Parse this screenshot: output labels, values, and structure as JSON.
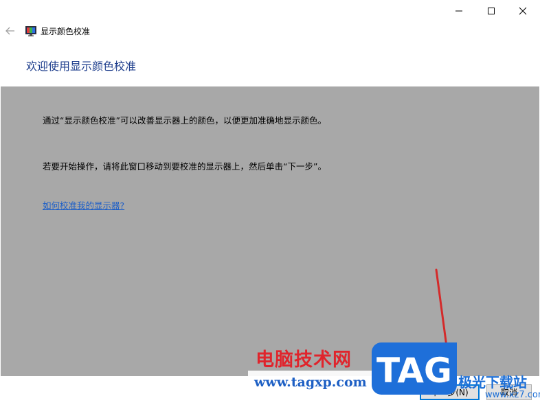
{
  "window": {
    "title": "显示颜色校准",
    "controls": {
      "minimize": "minimize-icon",
      "maximize": "maximize-icon",
      "close": "close-icon"
    }
  },
  "header": {
    "back_icon": "back-arrow-icon",
    "app_icon": "monitor-icon",
    "heading": "欢迎使用显示颜色校准"
  },
  "content": {
    "paragraph_1": "通过“显示颜色校准”可以改善显示器上的颜色，以便更加准确地显示颜色。",
    "paragraph_2": "若要开始操作，请将此窗口移动到要校准的显示器上，然后单击“下一步”。",
    "help_link": "如何校准我的显示器?"
  },
  "buttons": {
    "next_label": "下一步(N)",
    "cancel_label": "取消"
  },
  "watermark": {
    "site_name": "电脑技术网",
    "site_url": "www.tagxp.com",
    "logo_text": "TAG",
    "secondary_name": "极光下载站",
    "secondary_url": "www.xz7.com"
  },
  "colors": {
    "heading": "#1d3d8c",
    "panel_bg": "#a8a8a8",
    "link": "#1e5fc7",
    "focus_border": "#0078d7",
    "annotation": "#d42a2a"
  }
}
